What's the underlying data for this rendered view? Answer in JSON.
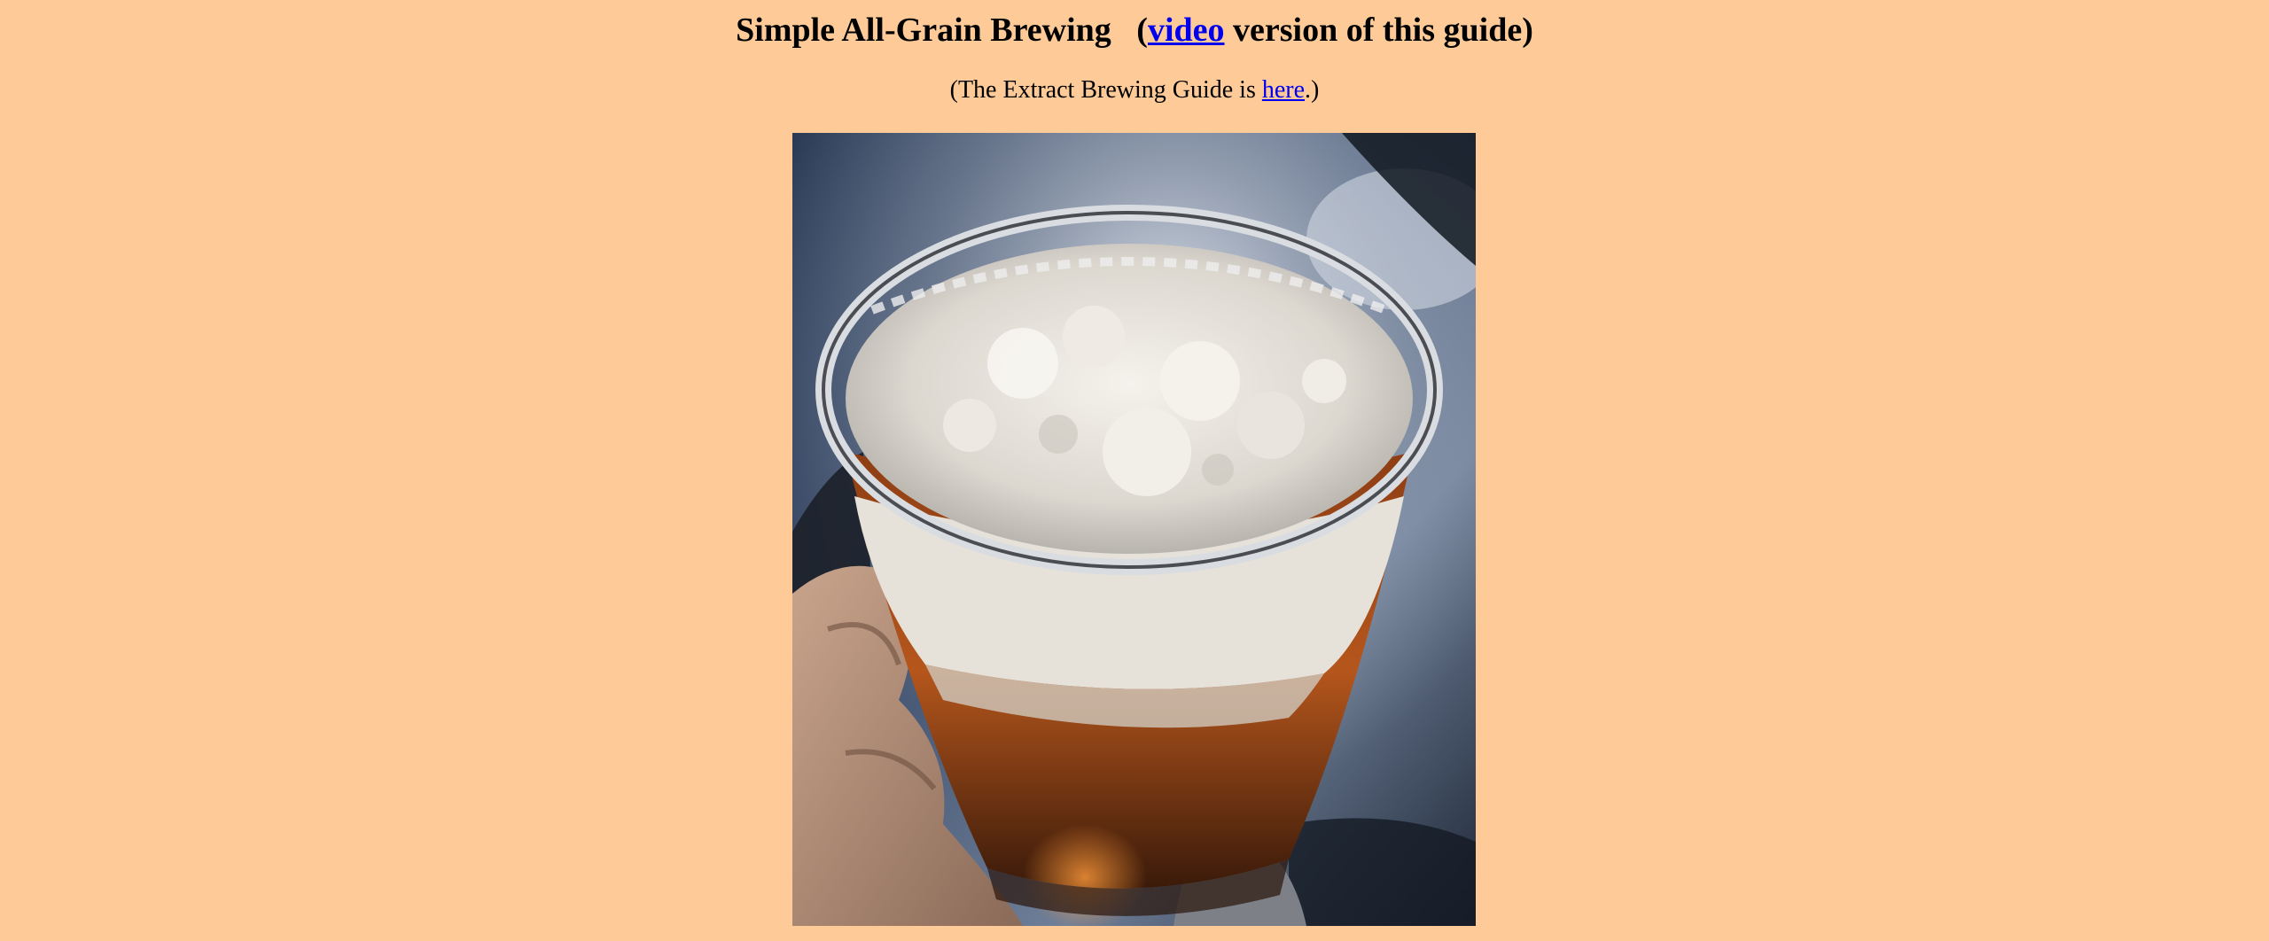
{
  "title": {
    "main": "Simple All-Grain Brewing",
    "paren_open": "(",
    "video_link": "video",
    "rest": " version of this guide)"
  },
  "subtitle": {
    "prefix": "(The Extract Brewing Guide is ",
    "link": "here",
    "suffix": ".)"
  },
  "photo": {
    "subject": "glass-of-beer-photo",
    "colors": {
      "background": "#FECB98",
      "link": "#0000EE",
      "beer": "#B3501A",
      "foam": "#ECE8E0",
      "sky": "#2E3C55"
    }
  }
}
